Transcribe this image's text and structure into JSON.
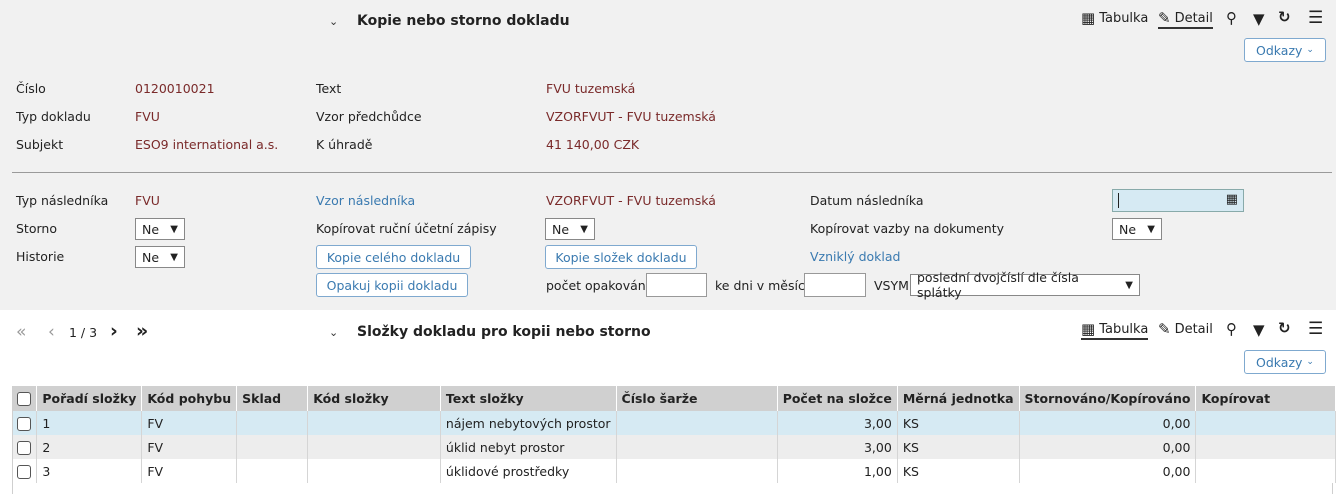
{
  "header": {
    "title": "Kopie nebo storno dokladu",
    "toolbar": {
      "table_label": "Tabulka",
      "detail_label": "Detail"
    },
    "odkazy_label": "Odkazy"
  },
  "info": {
    "cislo_label": "Číslo",
    "cislo_value": "0120010021",
    "typ_label": "Typ dokladu",
    "typ_value": "FVU",
    "subjekt_label": "Subjekt",
    "subjekt_value": "ESO9 international a.s.",
    "text_label": "Text",
    "text_value": "FVU tuzemská",
    "vzor_label": "Vzor předchůdce",
    "vzor_value": "VZORFVUT - FVU tuzemská",
    "uhrade_label": "K úhradě",
    "uhrade_value": "41 140,00 CZK"
  },
  "form": {
    "typ_nasl_label": "Typ následníka",
    "typ_nasl_value": "FVU",
    "storno_label": "Storno",
    "storno_value": "Ne",
    "historie_label": "Historie",
    "historie_value": "Ne",
    "vzor_nasl_label": "Vzor následníka",
    "vzor_nasl_value": "VZORFVUT - FVU tuzemská",
    "kop_rucni_label": "Kopírovat ruční účetní zápisy",
    "kop_rucni_value": "Ne",
    "kopie_celeho": "Kopie celého dokladu",
    "kopie_slozek": "Kopie složek dokladu",
    "opakuj": "Opakuj kopii dokladu",
    "pocet_label": "počet opakování",
    "ke_dni_label": "ke dni v měsíci",
    "vsym_label": "VSYM",
    "vsym_value": "poslední dvojčíslí dle čísla splátky",
    "datum_label": "Datum následníka",
    "kop_vazby_label": "Kopírovat vazby na dokumenty",
    "kop_vazby_value": "Ne",
    "vznikly": "Vzniklý doklad"
  },
  "section2": {
    "title": "Složky dokladu pro kopii nebo storno",
    "pager": "1 / 3",
    "toolbar": {
      "table_label": "Tabulka",
      "detail_label": "Detail"
    },
    "odkazy_label": "Odkazy"
  },
  "table": {
    "headers": [
      "Pořadí složky",
      "Kód pohybu",
      "Sklad",
      "Kód složky",
      "Text složky",
      "Číslo šarže",
      "Počet na složce",
      "Měrná jednotka",
      "Stornováno/Kopírováno",
      "Kopírovat"
    ],
    "rows": [
      [
        "1",
        "FV",
        "",
        "",
        "nájem nebytových prostor",
        "",
        "3,00",
        "KS",
        "0,00",
        ""
      ],
      [
        "2",
        "FV",
        "",
        "",
        "úklid nebyt prostor",
        "",
        "3,00",
        "KS",
        "0,00",
        ""
      ],
      [
        "3",
        "FV",
        "",
        "",
        "úklidové prostředky",
        "",
        "1,00",
        "KS",
        "0,00",
        ""
      ]
    ]
  }
}
